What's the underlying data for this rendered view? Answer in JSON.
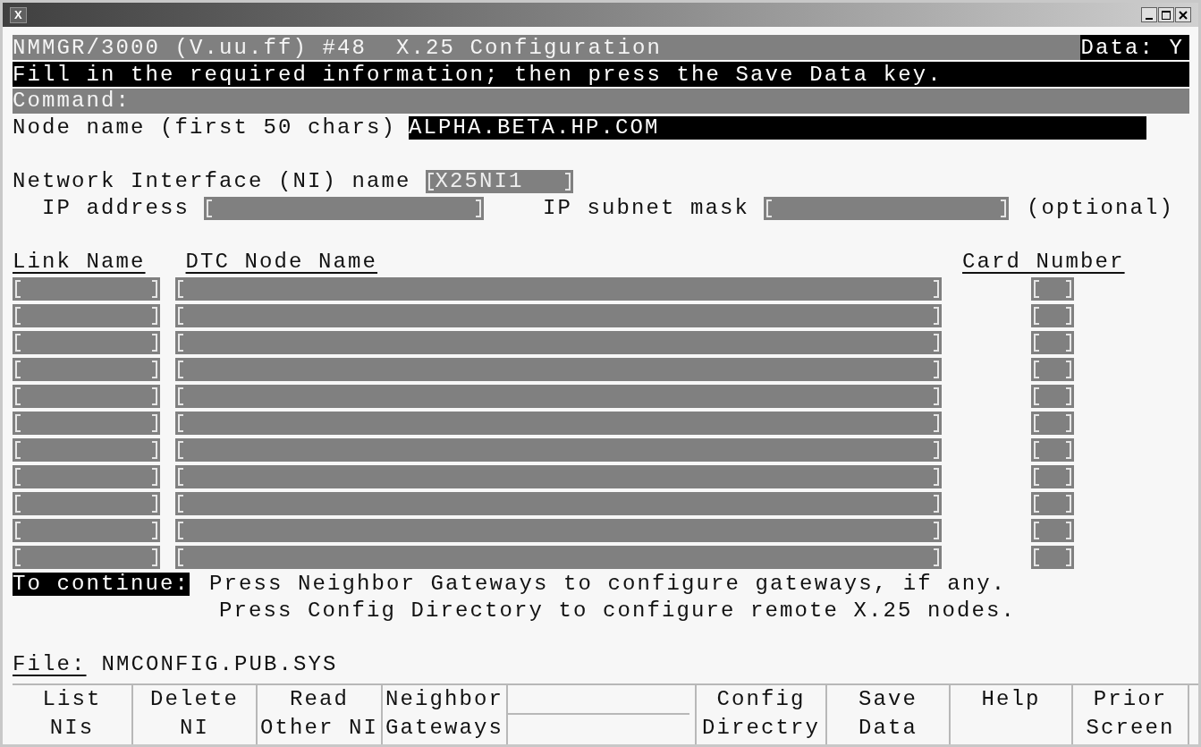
{
  "window": {
    "icon_text": "X"
  },
  "header": {
    "title": "NMMGR/3000 (V.uu.ff) #48  X.25 Configuration",
    "data_flag": "Data: Y"
  },
  "message": "Fill in the required information; then press the Save Data key.",
  "command": {
    "label": "Command:"
  },
  "node_name": {
    "label": "Node name (first 50 chars)",
    "value": "ALPHA.BETA.HP.COM"
  },
  "ni_name": {
    "label": "Network Interface (NI) name",
    "value": "X25NI1"
  },
  "ip_address": {
    "label": "IP address"
  },
  "subnet_mask": {
    "label": "IP subnet mask",
    "note": "(optional)"
  },
  "table": {
    "columns": [
      "Link Name",
      "DTC Node Name",
      "Card Number"
    ],
    "rows": [
      {
        "editable": true
      },
      {
        "editable": true
      },
      {
        "editable": true
      },
      {
        "editable": true
      },
      {
        "editable": true
      },
      {
        "editable": true
      },
      {
        "editable": true
      },
      {
        "editable": true
      },
      {
        "editable": true
      },
      {
        "editable": true
      },
      {
        "editable": true
      }
    ]
  },
  "continue": {
    "label": "To continue:",
    "lines": [
      "Press Neighbor Gateways to configure gateways, if any.",
      "Press Config Directory to configure remote X.25 nodes."
    ]
  },
  "file": {
    "label": "File:",
    "value": "NMCONFIG.PUB.SYS"
  },
  "function_keys": [
    {
      "kind": "label",
      "lines": [
        "List",
        "NIs"
      ]
    },
    {
      "kind": "label",
      "lines": [
        "Delete",
        "NI"
      ]
    },
    {
      "kind": "label",
      "lines": [
        "Read",
        "Other NI"
      ]
    },
    {
      "kind": "label",
      "lines": [
        "Neighbor",
        "Gateways"
      ]
    },
    {
      "kind": "blank"
    },
    {
      "kind": "label",
      "lines": [
        "Config",
        "Directry"
      ]
    },
    {
      "kind": "label",
      "lines": [
        "Save",
        "Data"
      ]
    },
    {
      "kind": "label",
      "lines": [
        "Help"
      ]
    },
    {
      "kind": "label",
      "lines": [
        "Prior",
        "Screen"
      ]
    }
  ]
}
